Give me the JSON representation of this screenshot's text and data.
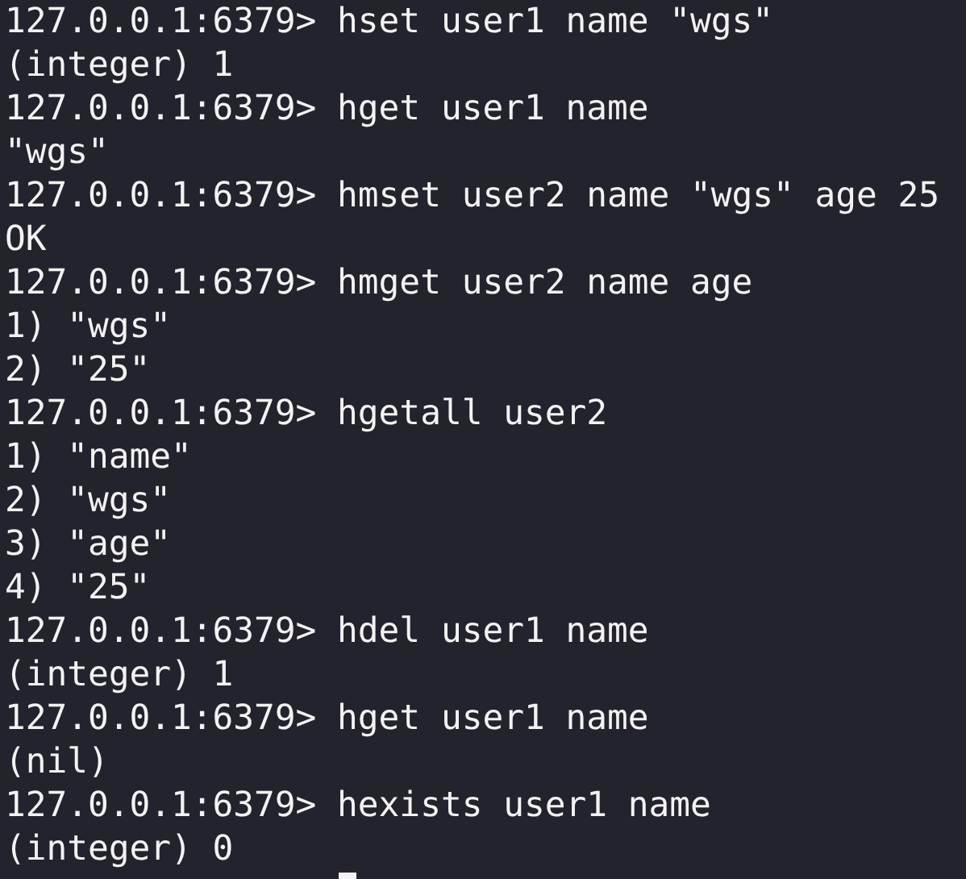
{
  "terminal": {
    "lines": [
      {
        "kind": "input",
        "prompt": "127.0.0.1:6379>",
        "command": "hset user1 name \"wgs\""
      },
      {
        "kind": "output",
        "text": "(integer) 1"
      },
      {
        "kind": "input",
        "prompt": "127.0.0.1:6379>",
        "command": "hget user1 name"
      },
      {
        "kind": "output",
        "text": "\"wgs\""
      },
      {
        "kind": "input",
        "prompt": "127.0.0.1:6379>",
        "command": "hmset user2 name \"wgs\" age 25"
      },
      {
        "kind": "output",
        "text": "OK"
      },
      {
        "kind": "input",
        "prompt": "127.0.0.1:6379>",
        "command": "hmget user2 name age"
      },
      {
        "kind": "output",
        "text": "1) \"wgs\""
      },
      {
        "kind": "output",
        "text": "2) \"25\""
      },
      {
        "kind": "input",
        "prompt": "127.0.0.1:6379>",
        "command": "hgetall user2"
      },
      {
        "kind": "output",
        "text": "1) \"name\""
      },
      {
        "kind": "output",
        "text": "2) \"wgs\""
      },
      {
        "kind": "output",
        "text": "3) \"age\""
      },
      {
        "kind": "output",
        "text": "4) \"25\""
      },
      {
        "kind": "input",
        "prompt": "127.0.0.1:6379>",
        "command": "hdel user1 name"
      },
      {
        "kind": "output",
        "text": "(integer) 1"
      },
      {
        "kind": "input",
        "prompt": "127.0.0.1:6379>",
        "command": "hget user1 name"
      },
      {
        "kind": "output",
        "text": "(nil)"
      },
      {
        "kind": "input",
        "prompt": "127.0.0.1:6379>",
        "command": "hexists user1 name"
      },
      {
        "kind": "output",
        "text": "(integer) 0"
      }
    ]
  }
}
